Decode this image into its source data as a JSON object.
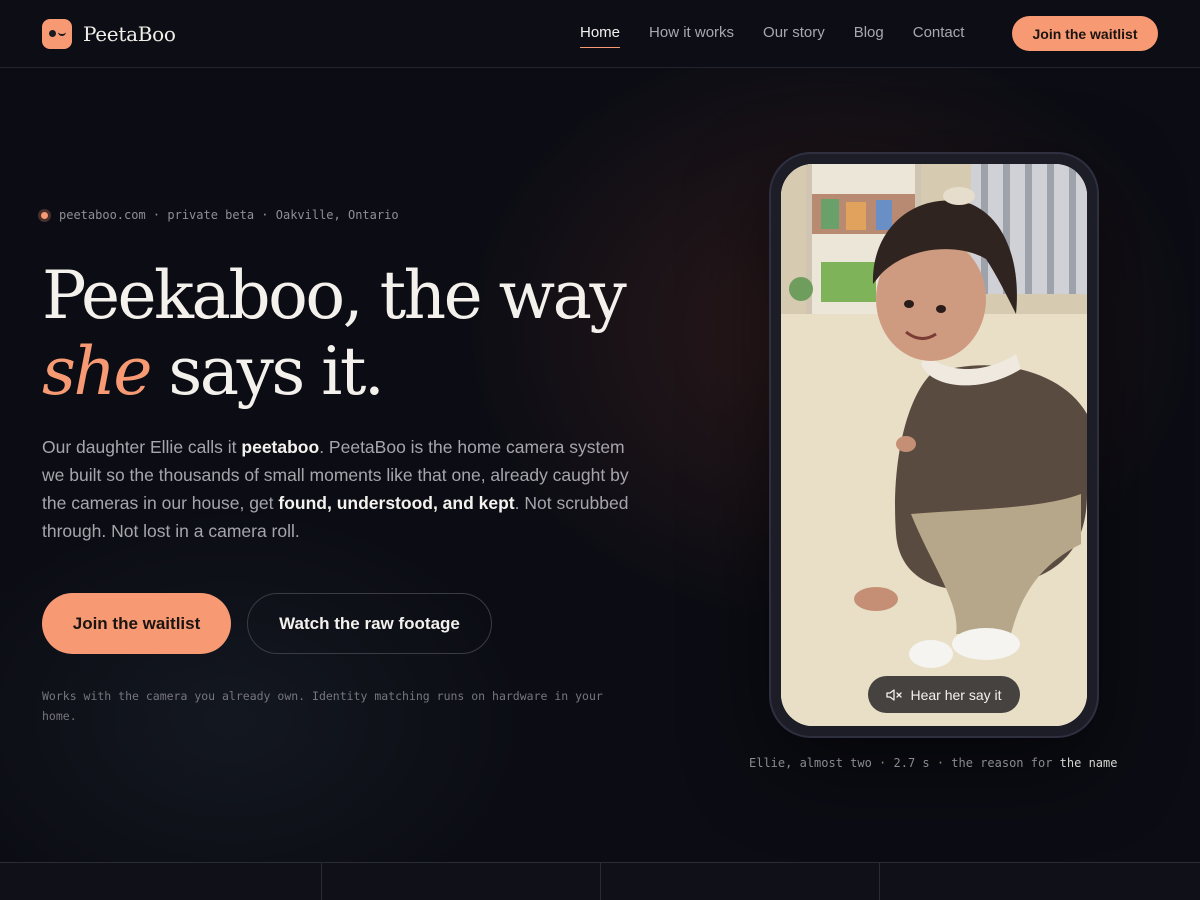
{
  "brand": {
    "name": "PeetaBoo",
    "accent": "#f79a74"
  },
  "nav": {
    "links": [
      "Home",
      "How it works",
      "Our story",
      "Blog",
      "Contact"
    ],
    "active": "Home",
    "cta": "Join the waitlist"
  },
  "hero": {
    "eyebrow": "peetaboo.com · private beta · Oakville, Ontario",
    "headline_line1": "Peekaboo, the way",
    "headline_accent": "she",
    "headline_rest": " says it.",
    "lede": {
      "p1": "Our daughter Ellie calls it ",
      "b1": "peetaboo",
      "p2": ". PeetaBoo is the home camera system we built so the thousands of small moments like that one, already caught by the cameras in our house, get ",
      "b2": "found, understood, and kept",
      "p3": ". Not scrubbed through. Not lost in a camera roll."
    },
    "primary_button": "Join the waitlist",
    "secondary_button": "Watch the raw footage",
    "footnote": "Works with the camera you already own. Identity matching runs on hardware in your home."
  },
  "media": {
    "audio_button": "Hear her say it",
    "audio_icon": "speaker-muted-icon",
    "caption_main": "Ellie, almost two · 2.7 s · the reason for ",
    "caption_strong": "the name"
  }
}
